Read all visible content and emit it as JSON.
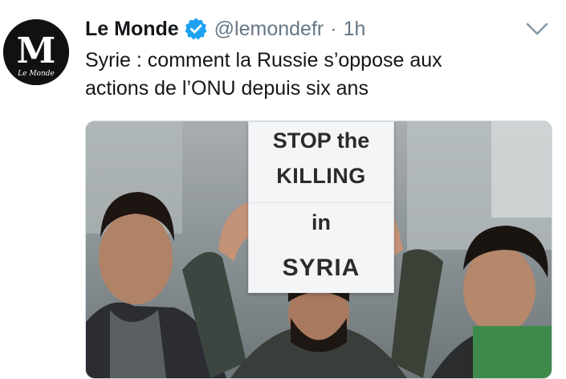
{
  "tweet": {
    "avatar": {
      "icon": "le-monde-logo-icon",
      "logo_letter": "M",
      "logo_text": "Le Monde"
    },
    "display_name": "Le Monde",
    "verified_icon": "verified-badge-icon",
    "handle": "@lemondefr",
    "separator": "·",
    "time": "1h",
    "caret_icon": "chevron-down-icon",
    "text_line1": "Syrie : comment la Russie s’oppose aux",
    "text_line2": "actions de l’ONU depuis six ans",
    "media": {
      "sign_line1": "STOP the",
      "sign_line2": "KILLING",
      "sign_line3": "in",
      "sign_line4": "SYRIA"
    }
  },
  "colors": {
    "text_primary": "#14171a",
    "text_secondary": "#657786",
    "verified_blue": "#1da1f2",
    "border": "#d5dce2"
  }
}
